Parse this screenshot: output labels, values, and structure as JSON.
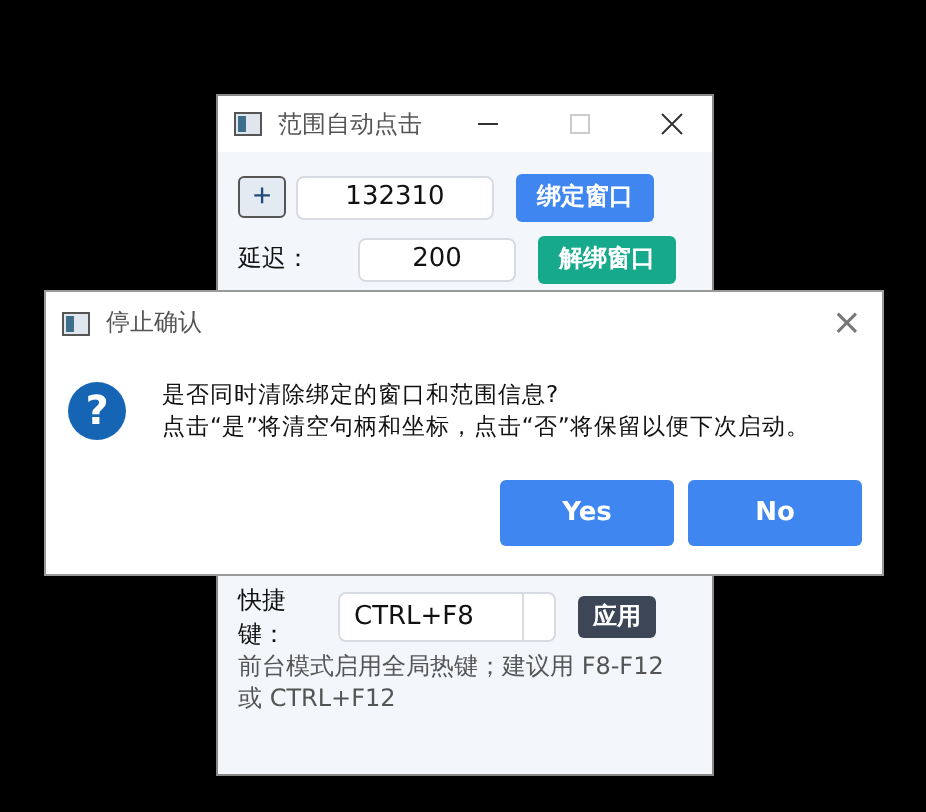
{
  "main_window": {
    "title": "范围自动点击",
    "handle_row": {
      "add_button": "+",
      "handle_value": "132310",
      "bind_button": "绑定窗口"
    },
    "delay_row": {
      "label": "延迟：",
      "delay_value": "200",
      "unbind_button": "解绑窗口"
    },
    "hotkey_row": {
      "label": "快捷键：",
      "hotkey_value": "CTRL+F8",
      "apply_button": "应用"
    },
    "hint": "前台模式启用全局热键；建议用 F8-F12 或 CTRL+F12"
  },
  "dialog": {
    "title": "停止确认",
    "close": "×",
    "icon_glyph": "?",
    "message_lines": [
      "是否同时清除绑定的窗口和范围信息?",
      "点击“是”将清空句柄和坐标，点击“否”将保留以便下次启动。"
    ],
    "buttons": [
      "Yes",
      "No"
    ]
  }
}
